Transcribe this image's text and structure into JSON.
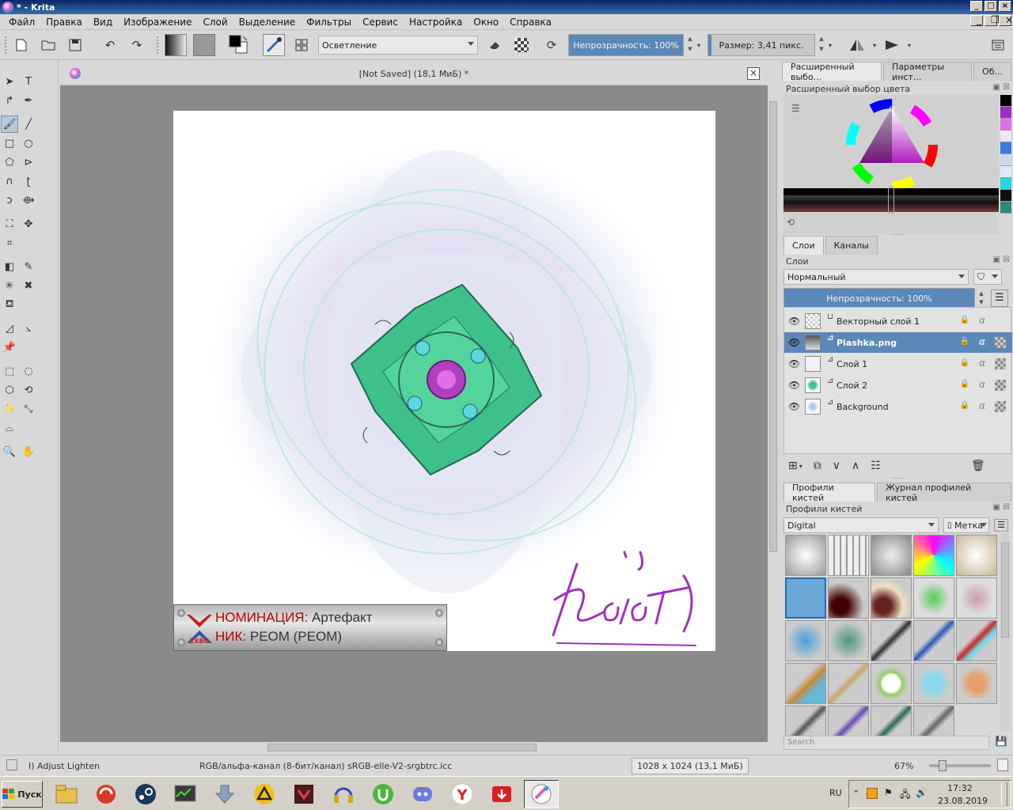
{
  "window": {
    "title": "* - Krita",
    "controls": [
      "_",
      "□",
      "×"
    ]
  },
  "menu": {
    "items": [
      "Файл",
      "Правка",
      "Вид",
      "Изображение",
      "Слой",
      "Выделение",
      "Фильтры",
      "Сервис",
      "Настройка",
      "Окно",
      "Справка"
    ],
    "right_controls": [
      "_",
      "❐",
      "×"
    ]
  },
  "toolbar": {
    "blend_mode": "Осветление",
    "opacity_label": "Непрозрачность:  100%",
    "opacity_value": 1.0,
    "size_label": "Размер:  3,41 пикс.",
    "size_value": 0.03
  },
  "document": {
    "tab_title": "[Not Saved]  (18,1 МиБ) *",
    "plate_nomination_label": "НОМИНАЦИЯ:",
    "plate_nomination_value": "Артефакт",
    "plate_nick_label": "НИК:",
    "plate_nick_value": "РЕОМ (PEOM)",
    "logo_text": "EXBO",
    "signature": "Келот"
  },
  "right_panel": {
    "top_tabs": [
      "Расширенный выбо...",
      "Параметры инст...",
      "Об..."
    ],
    "color_docker_title": "Расширенный выбор цвета",
    "layers_tabs": [
      "Слои",
      "Каналы"
    ],
    "layers_title": "Слои",
    "blend_select": "Нормальный",
    "layer_opacity_label": "Непрозрачность:  100%",
    "layers": [
      {
        "name": "Векторный слой 1",
        "selected": false
      },
      {
        "name": "Plashka.png",
        "selected": true
      },
      {
        "name": "Слой 1",
        "selected": false
      },
      {
        "name": "Слой 2",
        "selected": false
      },
      {
        "name": "Background",
        "selected": false
      }
    ],
    "brush_tabs": [
      "Профили кистей",
      "Журнал профилей кистей"
    ],
    "brush_title": "Профили кистей",
    "brush_tag": "Digital",
    "brush_tag_label": "Метка",
    "search_placeholder": "Search",
    "palette_colors": [
      "#000000",
      "#9b2fc0",
      "#e070e8",
      "#e8e8f0",
      "#3a7ad8",
      "#c8d8f0",
      "#e0e8f8",
      "#2ad0e8",
      "#101010",
      "#2a8a7a"
    ]
  },
  "status": {
    "tool": "I) Adjust Lighten",
    "colorspace": "RGB/альфа-канал (8-бит/канал)  sRGB-elle-V2-srgbtrc.icc",
    "dimensions": "1028 x 1024 (13,1 МиБ)",
    "zoom": "67%"
  },
  "taskbar": {
    "start_label": "Пуск",
    "lang": "RU",
    "time": "17:32",
    "date": "23.08.2019"
  },
  "colors": {
    "accent": "#5a88b8",
    "panel": "#d8d8d8",
    "canvas_bg": "#8a8a8a",
    "flower": "#3ec08a",
    "magenta": "#a030b0"
  }
}
